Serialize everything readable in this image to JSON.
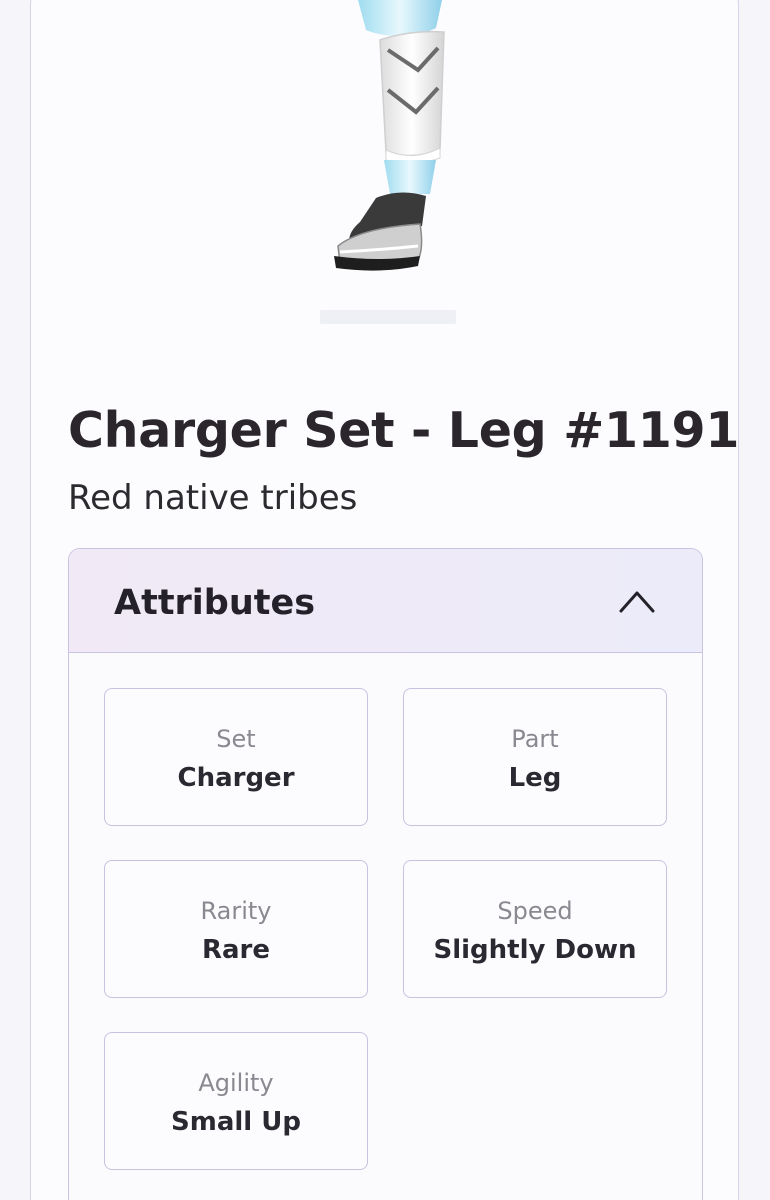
{
  "item": {
    "title": "Charger Set - Leg #1191",
    "subtitle": "Red native tribes"
  },
  "attributes": {
    "heading": "Attributes",
    "expanded": true,
    "items": [
      {
        "label": "Set",
        "value": "Charger"
      },
      {
        "label": "Part",
        "value": "Leg"
      },
      {
        "label": "Rarity",
        "value": "Rare"
      },
      {
        "label": "Speed",
        "value": "Slightly Down"
      },
      {
        "label": "Agility",
        "value": "Small Up"
      }
    ]
  },
  "colors": {
    "background": "#fafafd",
    "panel_border": "#c9c4e4",
    "header_gradient_start": "#f1eaf6",
    "header_gradient_end": "#ecebf9",
    "text_primary": "#2a262c",
    "text_muted": "#8a8890"
  },
  "icons": {
    "collapse": "chevron-up-icon"
  }
}
